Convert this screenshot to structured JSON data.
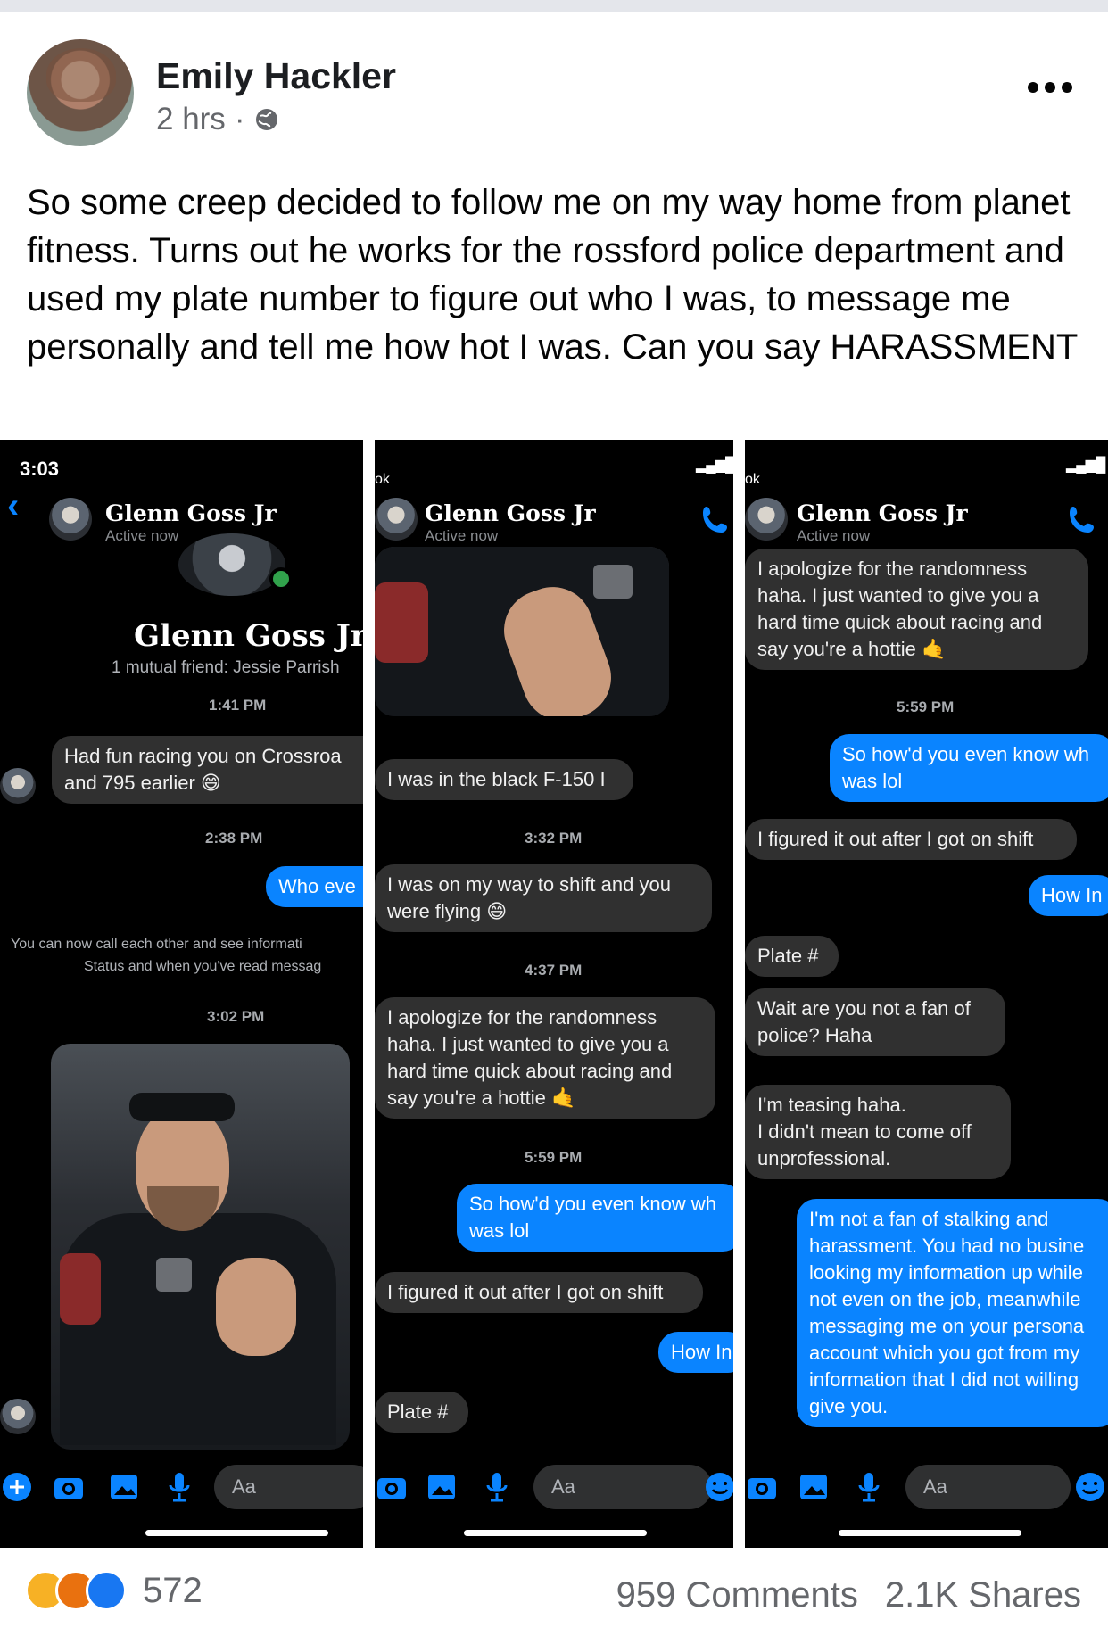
{
  "post": {
    "author": "Emily Hackler",
    "time": "2 hrs",
    "separator": "·",
    "text": "So some creep decided to follow me on my way home from planet fitness. Turns out he works for the rossford police department and used my plate number to figure out who I was, to message me personally and tell me how hot I was. Can you say HARASSMENT"
  },
  "screens": [
    {
      "status_time": "3:03",
      "contact": "Glenn Goss Jr",
      "contact_status": "Active now",
      "profile_name": "Glenn Goss Jr",
      "mutual": "1 mutual friend: Jessie Parrish",
      "ts1": "1:41 PM",
      "msg1": "Had fun racing you on Crossroa",
      "msg1b": "and 795 earlier 😄",
      "ts2": "2:38 PM",
      "out1": "Who eve",
      "sys1": "You can now call each other and see informati",
      "sys2": "Status and when you've read messag",
      "ts3": "3:02 PM",
      "composer_placeholder": "Aa"
    },
    {
      "status_small": "ok",
      "contact": "Glenn Goss Jr",
      "contact_status": "Active now",
      "msg1": "I was in the black F-150 I",
      "ts1": "3:32 PM",
      "msg2a": "I was on my way to shift and you",
      "msg2b": "were flying 😄",
      "ts2": "4:37 PM",
      "msg3": [
        "I apologize for the randomness",
        "haha. I just wanted to give you a",
        "hard time quick about racing and",
        "say you're a hottie 🤙"
      ],
      "ts3": "5:59 PM",
      "out1a": "So how'd you even know wh",
      "out1b": "was lol",
      "msg4": "I figured it out after I got on shift",
      "out2": "How In",
      "msg5": "Plate #",
      "composer_placeholder": "Aa"
    },
    {
      "status_small": "ok",
      "contact": "Glenn Goss Jr",
      "contact_status": "Active now",
      "msg1": [
        "I apologize for the randomness",
        "haha. I just wanted to give you a",
        "hard time quick about racing and",
        "say you're a hottie 🤙"
      ],
      "ts1": "5:59 PM",
      "out1a": "So how'd you even know wh",
      "out1b": "was lol",
      "msg2": "I figured it out after I got on shift",
      "out2": "How In",
      "msg3": "Plate #",
      "msg4a": "Wait are you not a fan of",
      "msg4b": "police? Haha",
      "msg5": [
        "I'm teasing haha.",
        "I didn't mean to come off",
        "unprofessional."
      ],
      "out3": [
        "I'm not a fan of stalking and",
        "harassment. You had no busine",
        "looking my information up while",
        "not even on the job, meanwhile",
        "messaging me on your persona",
        "account which you got from my",
        "information that I did not willing",
        "give you."
      ],
      "composer_placeholder": "Aa"
    }
  ],
  "footer": {
    "reaction_count": "572",
    "comments": "959 Comments",
    "shares": "2.1K Shares"
  },
  "colors": {
    "messenger_blue": "#0a84ff",
    "incoming_bubble": "#303030",
    "facebook_grey": "#65676b"
  }
}
